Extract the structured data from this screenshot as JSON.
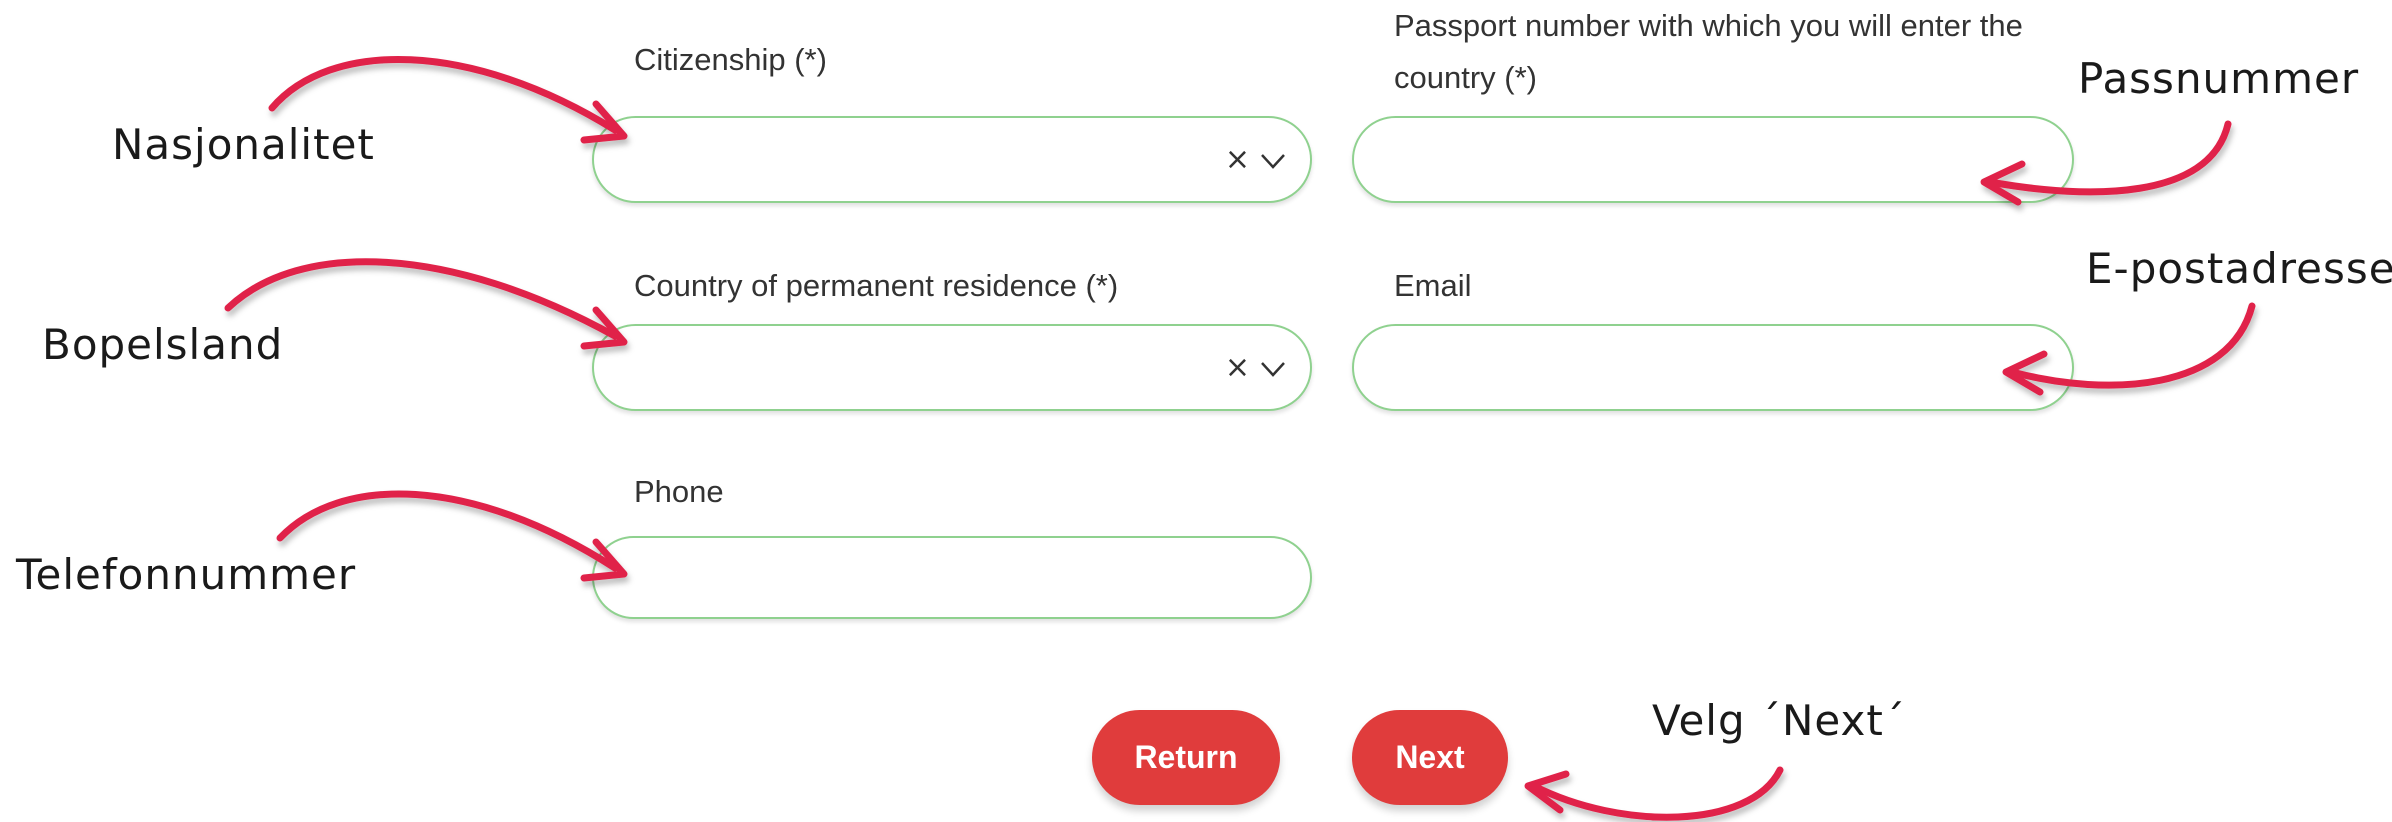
{
  "form": {
    "citizenship": {
      "label": "Citizenship (*)",
      "value": "",
      "clear_icon": "×"
    },
    "passport": {
      "label_line1": "Passport number with which you will enter the",
      "label_line2": "country (*)",
      "value": ""
    },
    "residence": {
      "label": "Country of permanent residence (*)",
      "value": "",
      "clear_icon": "×"
    },
    "email": {
      "label": "Email",
      "value": ""
    },
    "phone": {
      "label": "Phone",
      "value": ""
    }
  },
  "buttons": {
    "return_label": "Return",
    "next_label": "Next"
  },
  "annotations": {
    "citizenship": "Nasjonalitet",
    "passport": "Passnummer",
    "residence": "Bopelsland",
    "email": "E-postadresse",
    "phone": "Telefonnummer",
    "next": "Velg ´Next´"
  },
  "colors": {
    "field_border": "#8fd18f",
    "button": "#e03c3c",
    "arrow": "#e0244a"
  },
  "icons": [
    "clear-icon",
    "chevron-down-icon",
    "curved-arrow-icon"
  ]
}
